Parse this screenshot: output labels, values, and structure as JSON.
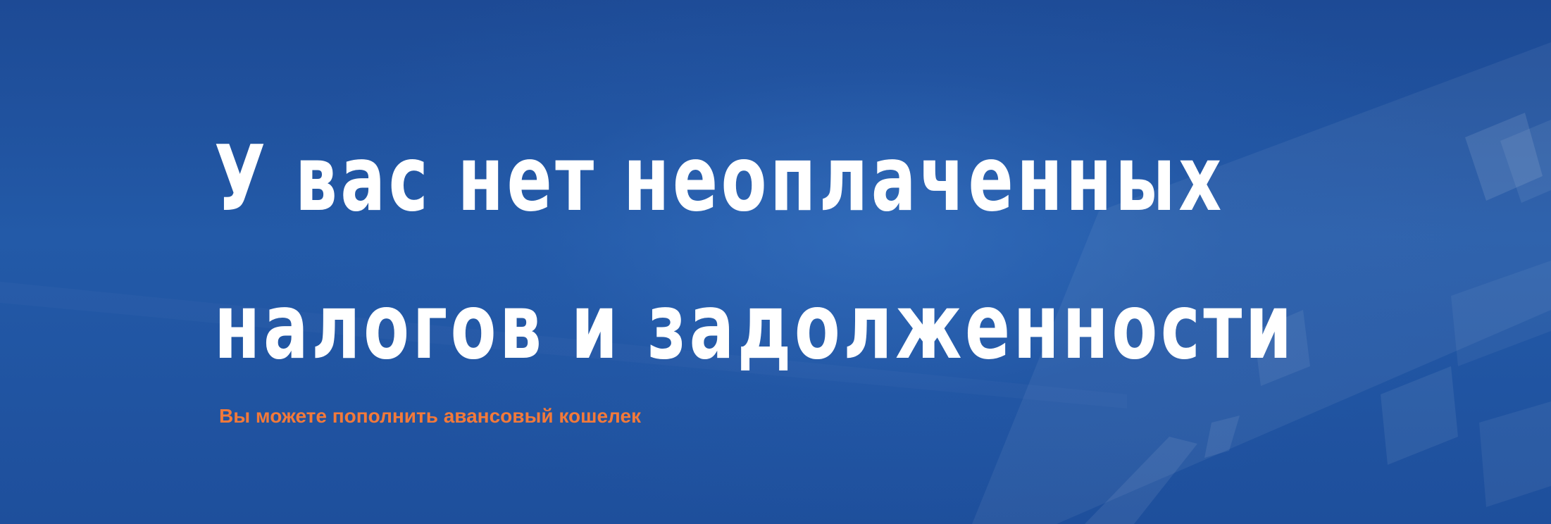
{
  "hero": {
    "headline_line1": "У вас нет неоплаченных",
    "headline_line2": "налогов и задолженности",
    "subtitle": "Вы можете пополнить авансовый кошелек"
  },
  "colors": {
    "background": "#1f4c9a",
    "headline": "#ffffff",
    "subtitle": "#f2793a",
    "logo": "#e8463a"
  },
  "icons": {
    "logo": "logo-icon"
  }
}
